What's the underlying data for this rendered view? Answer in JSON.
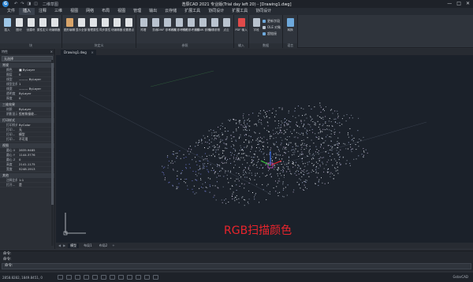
{
  "titlebar": {
    "title": "浩辰CAD 2021 专业版(Trial day left 20) - [Drawing1.dwg]",
    "workspace": "二维草图",
    "quick_access": [
      "↶",
      "↷",
      "◨",
      "◫"
    ],
    "controls": [
      "—",
      "□",
      "✕"
    ]
  },
  "menus": [
    "文件",
    "插入",
    "注释",
    "三维",
    "视图",
    "网络",
    "布局",
    "视图",
    "管理",
    "输出",
    "云存储",
    "扩展工具",
    "协同设计",
    "扩展工具",
    "协同设计"
  ],
  "active_menu_index": 1,
  "ribbon": {
    "groups": [
      {
        "title": "块",
        "buttons": [
          {
            "label": "插入",
            "icon": "insert-block-icon",
            "color": "#9ec7e8"
          },
          {
            "label": "图块",
            "icon": "block-icon",
            "color": "#e0e3e6"
          },
          {
            "label": "创建块",
            "icon": "create-block-icon",
            "color": "#e0e3e6"
          },
          {
            "label": "属性定义",
            "icon": "attribute-define-icon",
            "color": "#e0e3e6"
          },
          {
            "label": "块编辑器",
            "icon": "block-editor-icon",
            "color": "#e0e3e6"
          }
        ]
      },
      {
        "title": "块定义",
        "buttons": [
          {
            "label": "图形编辑",
            "icon": "edit-attribute-icon",
            "color": "#d8a46a"
          },
          {
            "label": "显示全部",
            "icon": "show-all-icon",
            "color": "#e0e3e6"
          },
          {
            "label": "管理属性",
            "icon": "manage-attribute-icon",
            "color": "#e0e3e6"
          },
          {
            "label": "同步属性",
            "icon": "sync-attribute-icon",
            "color": "#e0e3e6"
          },
          {
            "label": "块编辑器",
            "icon": "block-editor2-icon",
            "color": "#e0e3e6"
          },
          {
            "label": "设置基点",
            "icon": "set-basepoint-icon",
            "color": "#e0e3e6"
          }
        ]
      },
      {
        "title": "参照",
        "buttons": [
          {
            "label": "附着",
            "icon": "attach-icon",
            "color": "#b9c3cf"
          },
          {
            "label": "剪裁",
            "icon": "clip-icon",
            "color": "#b9c3cf"
          },
          {
            "label": "DWF 参考底图",
            "icon": "dwf-underlay-icon",
            "color": "#b9c3cf"
          },
          {
            "label": "DGN 参考底图",
            "icon": "dgn-underlay-icon",
            "color": "#b9c3cf"
          },
          {
            "label": "PDF 参考底图",
            "icon": "pdf-underlay-icon",
            "color": "#b9c3cf"
          },
          {
            "label": "DRAW 参照",
            "icon": "draw-reference-icon",
            "color": "#b9c3cf"
          },
          {
            "label": "编辑参照",
            "icon": "edit-reference-icon",
            "color": "#b9c3cf"
          },
          {
            "label": "点云",
            "icon": "point-cloud-icon",
            "color": "#b9c3cf"
          }
        ]
      },
      {
        "title": "输入",
        "buttons": [
          {
            "label": "PDF 输入",
            "icon": "pdf-import-icon",
            "color": "#e04a4a"
          }
        ]
      },
      {
        "title": "数据",
        "buttons": [
          {
            "label": "字段",
            "icon": "field-icon",
            "color": "#b9c3cf"
          }
        ],
        "list": [
          {
            "label": "更新字段",
            "color": "#6ea9dc"
          },
          {
            "label": "OLE 对象",
            "color": "#b9c3cf"
          },
          {
            "label": "超链接",
            "color": "#6ea9dc"
          }
        ]
      },
      {
        "title": "语言",
        "buttons": [
          {
            "label": "转换",
            "icon": "language-convert-icon",
            "color": "#6ea9dc"
          }
        ]
      }
    ]
  },
  "left_panel": {
    "header": "特性",
    "selection": "无选择",
    "sections": [
      {
        "title": "常规",
        "rows": [
          {
            "k": "颜色",
            "v": "■ ByLayer"
          },
          {
            "k": "图层",
            "v": "0"
          },
          {
            "k": "线型",
            "v": "——— ByLayer"
          },
          {
            "k": "线型比例",
            "v": "1"
          },
          {
            "k": "线宽",
            "v": "——— ByLayer"
          },
          {
            "k": "透明度",
            "v": "ByLayer"
          },
          {
            "k": "厚度",
            "v": "0"
          }
        ]
      },
      {
        "title": "三维效果",
        "rows": [
          {
            "k": "材质",
            "v": "ByLayer"
          },
          {
            "k": "阴影显示",
            "v": "投射和接收..."
          }
        ]
      },
      {
        "title": "打印样式",
        "rows": [
          {
            "k": "打印样式",
            "v": "ByColor"
          },
          {
            "k": "打印...",
            "v": "无"
          },
          {
            "k": "打印...",
            "v": "模型"
          },
          {
            "k": "打印...",
            "v": "不可用"
          }
        ]
      },
      {
        "title": "视图",
        "rows": [
          {
            "k": "圆心 X",
            "v": "2835.9485"
          },
          {
            "k": "圆心 Y",
            "v": "1144.3776"
          },
          {
            "k": "圆心 Z",
            "v": "0"
          },
          {
            "k": "高度",
            "v": "2141.1175"
          },
          {
            "k": "宽度",
            "v": "5248.1913"
          }
        ]
      },
      {
        "title": "其他",
        "rows": [
          {
            "k": "注释比例",
            "v": "1:1"
          },
          {
            "k": "打开...",
            "v": "是"
          }
        ]
      }
    ]
  },
  "doc_tab": "Drawing1.dwg",
  "canvas": {
    "caption": "RGB扫描颜色",
    "background": "#1b212a",
    "axis_colors": {
      "x": "#e8242c",
      "y": "#3ac43a",
      "z": "#3a6ee8"
    }
  },
  "layout_tabs": [
    "模型",
    "布局1",
    "布局2"
  ],
  "command": {
    "history": [
      "命令:",
      "命令:"
    ],
    "input_prompt": "命令:"
  },
  "status": {
    "coords": "2858.8282, 1849.8451, 0",
    "brand": "GstarCAD"
  }
}
